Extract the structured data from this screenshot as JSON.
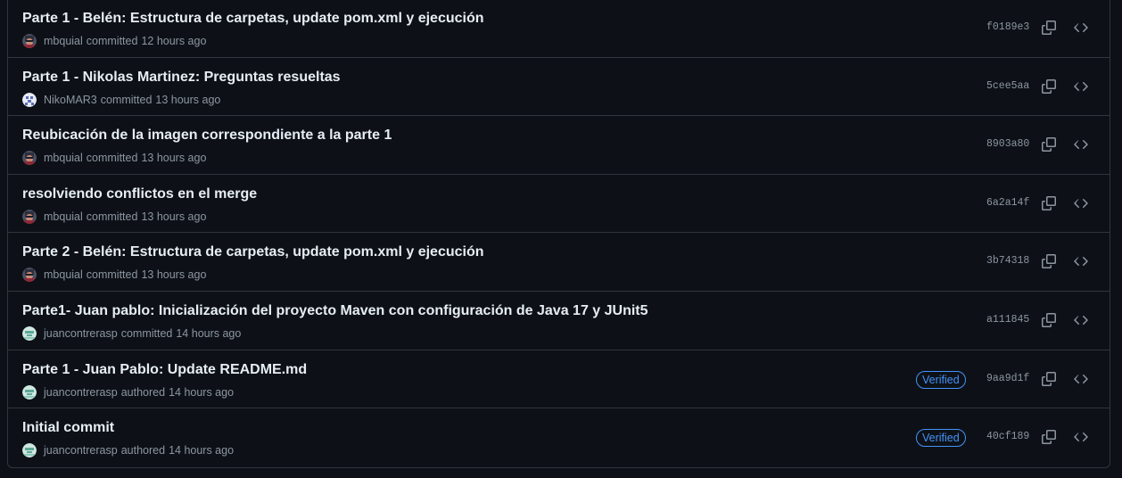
{
  "commits": [
    {
      "title": "Parte 1 - Belén: Estructura de carpetas, update pom.xml y ejecución",
      "author": "mbquial",
      "verb": "committed",
      "time": "12 hours ago",
      "sha": "f0189e3",
      "verified": false,
      "avatar": "mbquial-avatar"
    },
    {
      "title": "Parte 1 - Nikolas Martinez: Preguntas resueltas",
      "author": "NikoMAR3",
      "verb": "committed",
      "time": "13 hours ago",
      "sha": "5cee5aa",
      "verified": false,
      "avatar": "nikomar3-avatar"
    },
    {
      "title": "Reubicación de la imagen correspondiente a la parte 1",
      "author": "mbquial",
      "verb": "committed",
      "time": "13 hours ago",
      "sha": "8903a80",
      "verified": false,
      "avatar": "mbquial-avatar"
    },
    {
      "title": "resolviendo conflictos en el merge",
      "author": "mbquial",
      "verb": "committed",
      "time": "13 hours ago",
      "sha": "6a2a14f",
      "verified": false,
      "avatar": "mbquial-avatar"
    },
    {
      "title": "Parte 2 - Belén: Estructura de carpetas, update pom.xml y ejecución",
      "author": "mbquial",
      "verb": "committed",
      "time": "13 hours ago",
      "sha": "3b74318",
      "verified": false,
      "avatar": "mbquial-avatar"
    },
    {
      "title": "Parte1- Juan pablo: Inicialización del proyecto Maven con configuración de Java 17 y JUnit5",
      "author": "juancontrerasp",
      "verb": "committed",
      "time": "14 hours ago",
      "sha": "a111845",
      "verified": false,
      "avatar": "juancontrerasp-avatar"
    },
    {
      "title": "Parte 1 - Juan Pablo: Update README.md",
      "author": "juancontrerasp",
      "verb": "authored",
      "time": "14 hours ago",
      "sha": "9aa9d1f",
      "verified": true,
      "avatar": "juancontrerasp-avatar"
    },
    {
      "title": "Initial commit",
      "author": "juancontrerasp",
      "verb": "authored",
      "time": "14 hours ago",
      "sha": "40cf189",
      "verified": true,
      "avatar": "juancontrerasp-avatar"
    }
  ],
  "verified_label": "Verified",
  "icons": {
    "copy": "copy-icon",
    "browse": "code-icon"
  },
  "colors": {
    "background": "#0d1117",
    "border": "#30363d",
    "title": "#e6edf3",
    "muted": "#8d96a0",
    "verified": "#4493f8"
  }
}
